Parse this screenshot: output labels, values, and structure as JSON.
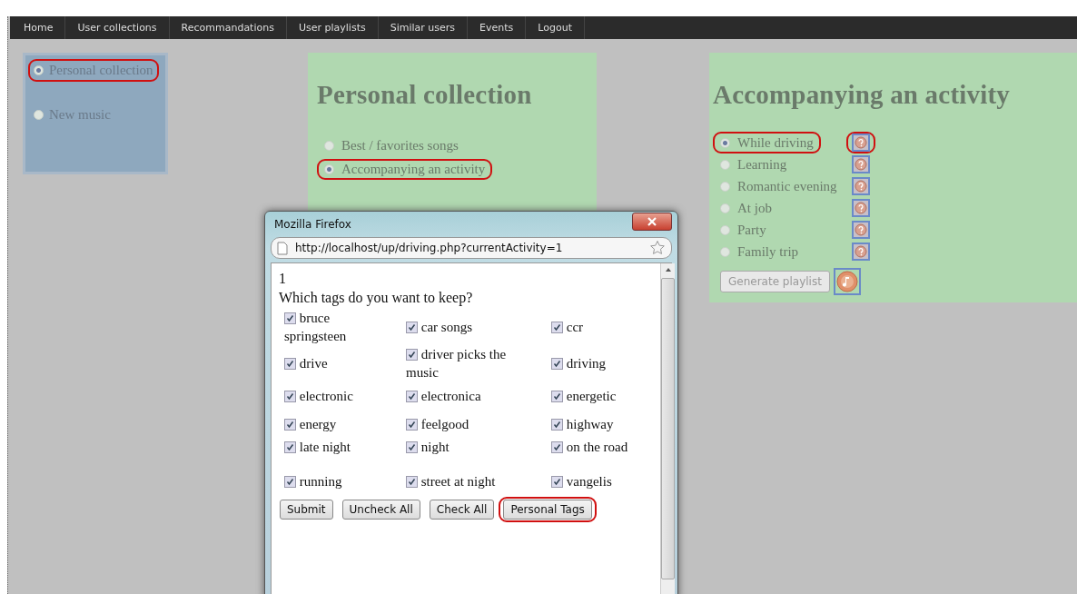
{
  "nav": [
    {
      "label": "Home"
    },
    {
      "label": "User collections"
    },
    {
      "label": "Recommandations"
    },
    {
      "label": "User playlists"
    },
    {
      "label": "Similar users"
    },
    {
      "label": "Events"
    },
    {
      "label": "Logout"
    }
  ],
  "sidebar": {
    "items": [
      {
        "label": "Personal collection",
        "selected": true,
        "highlighted": true
      },
      {
        "label": "New music",
        "selected": false,
        "highlighted": false
      }
    ]
  },
  "collection_panel": {
    "title": "Personal collection",
    "options": [
      {
        "label": "Best / favorites songs",
        "selected": false,
        "highlighted": false
      },
      {
        "label": "Accompanying an activity",
        "selected": true,
        "highlighted": true
      }
    ]
  },
  "activity_panel": {
    "title": "Accompanying an activity",
    "activities": [
      {
        "label": "While driving",
        "selected": true,
        "highlighted": true,
        "icon_highlighted": true
      },
      {
        "label": "Learning",
        "selected": false,
        "highlighted": false,
        "icon_highlighted": false
      },
      {
        "label": "Romantic evening",
        "selected": false,
        "highlighted": false,
        "icon_highlighted": false
      },
      {
        "label": "At job",
        "selected": false,
        "highlighted": false,
        "icon_highlighted": false
      },
      {
        "label": "Party",
        "selected": false,
        "highlighted": false,
        "icon_highlighted": false
      },
      {
        "label": "Family trip",
        "selected": false,
        "highlighted": false,
        "icon_highlighted": false
      }
    ],
    "generate_button": {
      "label": "Generate playlist",
      "disabled": true
    }
  },
  "popup": {
    "title": "Mozilla Firefox",
    "url": "http://localhost/up/driving.php?currentActivity=1",
    "line_1": "1",
    "question": "Which tags do you want to keep?",
    "tags": [
      {
        "label": "bruce springsteen",
        "checked": true
      },
      {
        "label": "car songs",
        "checked": true
      },
      {
        "label": "ccr",
        "checked": true
      },
      {
        "label": "drive",
        "checked": true
      },
      {
        "label": "driver picks the music",
        "checked": true
      },
      {
        "label": "driving",
        "checked": true
      },
      {
        "label": "electronic",
        "checked": true
      },
      {
        "label": "electronica",
        "checked": true
      },
      {
        "label": "energetic",
        "checked": true
      },
      {
        "label": "energy",
        "checked": true
      },
      {
        "label": "feelgood",
        "checked": true
      },
      {
        "label": "highway",
        "checked": true
      },
      {
        "label": "late night",
        "checked": true
      },
      {
        "label": "night",
        "checked": true
      },
      {
        "label": "on the road",
        "checked": true
      },
      {
        "label": "running",
        "checked": true
      },
      {
        "label": "street at night",
        "checked": true
      },
      {
        "label": "vangelis",
        "checked": true
      }
    ],
    "buttons": [
      {
        "label": "Submit",
        "highlighted": false
      },
      {
        "label": "Uncheck All",
        "highlighted": false
      },
      {
        "label": "Check All",
        "highlighted": false
      },
      {
        "label": "Personal Tags",
        "highlighted": true
      }
    ]
  }
}
